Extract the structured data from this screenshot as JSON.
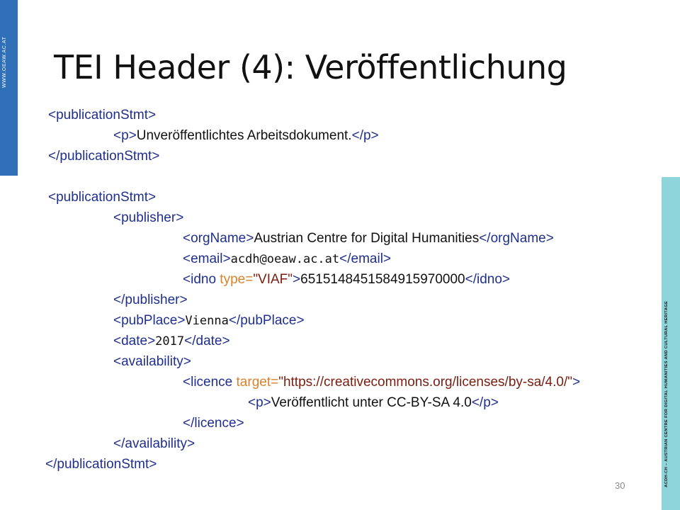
{
  "sidebar_left": {
    "text": "WWW.OEAW.AC.AT"
  },
  "sidebar_right": {
    "text": "ACDH-CH – AUSTRIAN CENTRE FOR DIGITAL HUMANITIES AND CULTURAL HERITAGE"
  },
  "slide": {
    "title": "TEI Header (4): Veröffentlichung",
    "page_number": "30"
  },
  "code": {
    "l1_open": "<publicationStmt>",
    "l2_p_open": "<p>",
    "l2_text": "Unveröffentlichtes Arbeitsdokument.",
    "l2_p_close": "</p>",
    "l3_close": "</publicationStmt>",
    "l5_open": "<publicationStmt>",
    "l6_publisher_open": "<publisher>",
    "l7_org_open": "<orgName>",
    "l7_text": "Austrian Centre for Digital Humanities",
    "l7_org_close": "</orgName>",
    "l8_email_open": "<email>",
    "l8_text": "acdh@oeaw.ac.at",
    "l8_email_close": "</email>",
    "l9_idno_open": "<idno ",
    "l9_attr": "type=",
    "l9_val": "\"VIAF\"",
    "l9_gt": ">",
    "l9_text": "6515148451584915970000",
    "l9_idno_close": "</idno>",
    "l10_publisher_close": "</publisher>",
    "l11_pubplace_open": "<pubPlace>",
    "l11_text": "Vienna",
    "l11_pubplace_close": "</pubPlace>",
    "l12_date_open": "<date>",
    "l12_text": "2017",
    "l12_date_close": "</date>",
    "l13_avail_open": "<availability>",
    "l14_licence_open": "<licence ",
    "l14_attr": "target=",
    "l14_val": "\"https://creativecommons.org/licenses/by-sa/4.0/\"",
    "l14_gt": ">",
    "l15_p_open": "<p>",
    "l15_text": "Veröffentlicht unter CC-BY-SA 4.0",
    "l15_p_close": "</p>",
    "l16_licence_close": "</licence>",
    "l17_avail_close": "</availability>",
    "l18_close": "</publicationStmt>"
  }
}
